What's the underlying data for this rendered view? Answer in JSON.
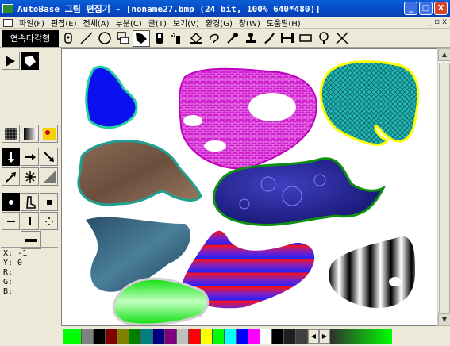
{
  "window": {
    "title": "AutoBase 그림 편집기 - [noname27.bmp (24 bit, 100% 640*480)]",
    "buttons": {
      "minimize": "_",
      "maximize": "□",
      "close": "X"
    }
  },
  "menubar": {
    "items": [
      "파일(F)",
      "편집(E)",
      "전체(A)",
      "부분(C)",
      "글(T)",
      "보기(V)",
      "환경(G)",
      "창(W)",
      "도움말(H)"
    ],
    "mdi_buttons": [
      "_",
      "▫",
      "x"
    ]
  },
  "toolbar": {
    "mode_label": "연속다각형",
    "tools": [
      "hand-cursor-icon",
      "line-icon",
      "circle-icon",
      "rect-overlap-icon",
      "polygon-fill-icon",
      "phone-icon",
      "spray-icon",
      "paint-bucket-icon",
      "lasso-icon",
      "eyedropper-icon",
      "stamp-icon",
      "brush-icon",
      "stretch-icon",
      "frame-icon",
      "magnifier-icon",
      "cross-icon"
    ],
    "active_tool": "polygon-fill-icon",
    "colors": {
      "accent": "#0548c6",
      "close": "#d8442a"
    }
  },
  "left_panel": {
    "coords": {
      "x": "X: -1",
      "y": "Y: 0",
      "r": "R:",
      "g": "G:",
      "b": "B:"
    }
  },
  "palette": {
    "current": "#00ff00",
    "swatches": [
      "#808080",
      "#000000",
      "#800000",
      "#808000",
      "#008000",
      "#008080",
      "#000080",
      "#800080",
      "#c0c0c0",
      "#ff0000",
      "#ffff00",
      "#00ff00",
      "#00ffff",
      "#0000ff",
      "#ff00ff",
      "#ffffff",
      "#000000",
      "#101010",
      "#202020",
      "#303030",
      "#404040",
      "#505050"
    ],
    "gradient_end": "#00ff00"
  }
}
